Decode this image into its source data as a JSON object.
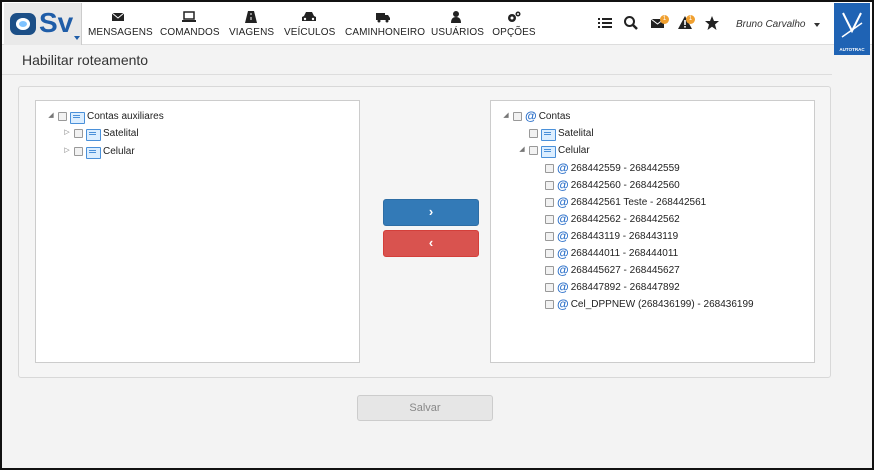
{
  "header": {
    "logo_text": "Sv",
    "nav": [
      {
        "label": "MENSAGENS",
        "icon": "envelope-icon"
      },
      {
        "label": "COMANDOS",
        "icon": "laptop-icon"
      },
      {
        "label": "VIAGENS",
        "icon": "road-icon"
      },
      {
        "label": "VEÍCULOS",
        "icon": "car-icon"
      },
      {
        "label": "CAMINHONEIRO",
        "icon": "truck-icon"
      },
      {
        "label": "USUÁRIOS",
        "icon": "user-icon"
      },
      {
        "label": "OPÇÕES",
        "icon": "cogs-icon"
      }
    ],
    "right_icons": [
      "list-icon",
      "search-icon",
      "mail-alert-icon",
      "warning-icon",
      "star-icon"
    ],
    "mail_badge": "1",
    "warning_badge": "1",
    "user_name": "Bruno Carvalho",
    "brand_text": "AUTOTRAC"
  },
  "page": {
    "title": "Habilitar roteamento"
  },
  "left_tree": {
    "root": "Contas auxiliares",
    "children": [
      "Satelital",
      "Celular"
    ]
  },
  "right_tree": {
    "root": "Contas",
    "satelital": "Satelital",
    "celular": "Celular",
    "celular_items": [
      "268442559 - 268442559",
      "268442560 - 268442560",
      "268442561 Teste - 268442561",
      "268442562 - 268442562",
      "268443119 - 268443119",
      "268444011 - 268444011",
      "268445627 - 268445627",
      "268447892 - 268447892",
      "Cel_DPPNEW (268436199) - 268436199"
    ]
  },
  "buttons": {
    "move_right": "›",
    "move_left": "‹",
    "save": "Salvar"
  },
  "colors": {
    "primary": "#337ab7",
    "danger": "#d9534f",
    "brand": "#1f63b4"
  }
}
